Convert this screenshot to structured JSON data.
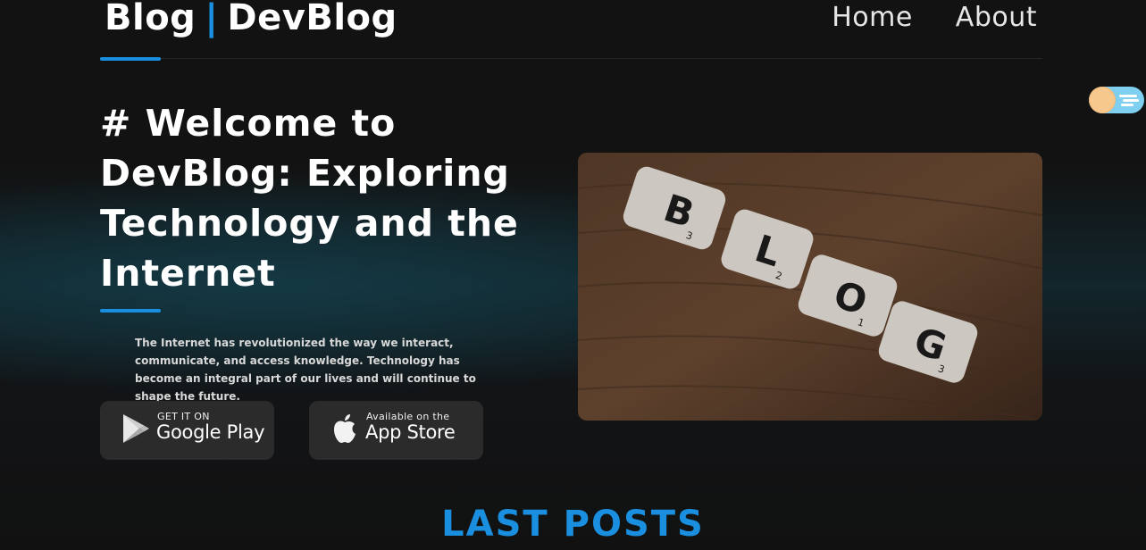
{
  "header": {
    "brand_left": "Blog",
    "brand_separator": "|",
    "brand_right": "DevBlog",
    "nav": [
      {
        "label": "Home"
      },
      {
        "label": "About"
      }
    ]
  },
  "hero": {
    "title": "# Welcome to DevBlog: Exploring Technology and the Internet",
    "description": "The Internet has revolutionized the way we interact, communicate, and access knowledge. Technology has become an integral part of our lives and will continue to shape the future.",
    "image_tiles": [
      "B",
      "L",
      "O",
      "G"
    ],
    "image_tile_numbers": [
      "3",
      "2",
      "1",
      "3"
    ]
  },
  "store_buttons": {
    "google": {
      "small": "GET IT ON",
      "big": "Google Play"
    },
    "apple": {
      "small": "Available on the",
      "big": "App Store"
    }
  },
  "section": {
    "title": "LAST POSTS"
  },
  "colors": {
    "accent": "#1a8fe0",
    "background": "#111111",
    "toggle": "#7fcff0"
  },
  "icons": [
    "google-play-icon",
    "apple-icon",
    "theme-toggle"
  ]
}
